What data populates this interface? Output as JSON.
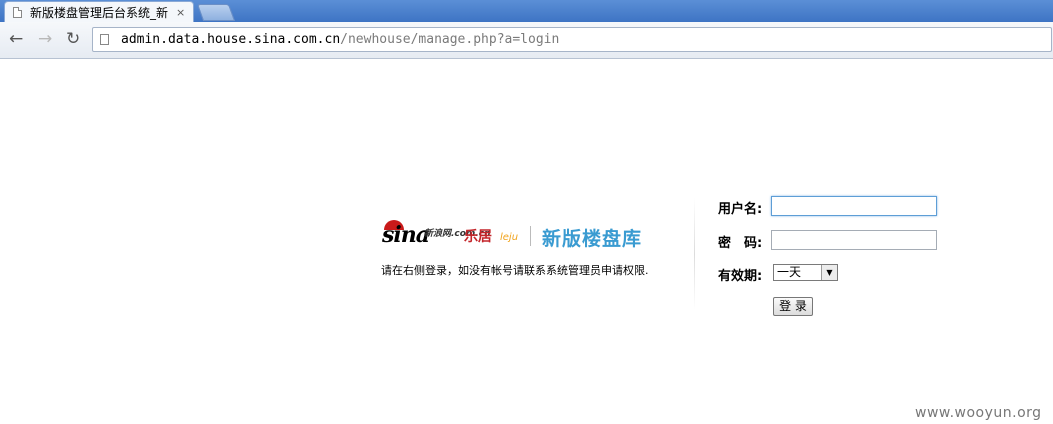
{
  "browser": {
    "tab_title": "新版楼盘管理后台系统_新",
    "tab_close": "×",
    "url_host": "admin.data.house.sina.com.cn",
    "url_path": "/newhouse/manage.php?a=login",
    "back": "←",
    "forward": "→",
    "reload": "↻"
  },
  "brand": {
    "sina": "sina",
    "sina_sub": "新浪网.com.cn",
    "leju": "乐居",
    "leju_en": "leju",
    "library": "新版楼盘库"
  },
  "hint": "请在右侧登录，如没有帐号请联系系统管理员申请权限.",
  "form": {
    "username_label": "用户名:",
    "username_value": "",
    "password_label": "密　码:",
    "password_value": "",
    "validity_label": "有效期:",
    "validity_selected": "一天",
    "submit_label": "登 录"
  },
  "watermark": "www.wooyun.org"
}
